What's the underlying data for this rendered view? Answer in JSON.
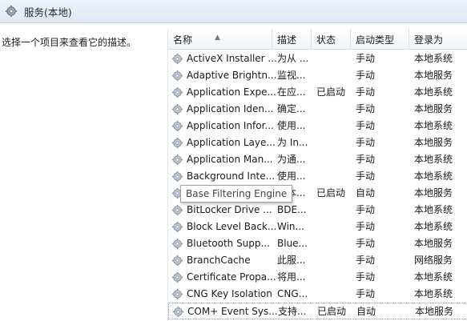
{
  "window": {
    "title": "服务(本地)",
    "icon": "services-gear-icon"
  },
  "description_pane": {
    "text": "选择一个项目来查看它的描述。"
  },
  "table": {
    "columns": [
      {
        "label": "名称",
        "sorted": "ascending"
      },
      {
        "label": "描述"
      },
      {
        "label": "状态"
      },
      {
        "label": "启动类型"
      },
      {
        "label": "登录为"
      }
    ],
    "rows": [
      {
        "name": "ActiveX Installer ...",
        "description": "为从 ...",
        "status": "",
        "startup": "手动",
        "logon": "本地系统"
      },
      {
        "name": "Adaptive Brightn...",
        "description": "监视...",
        "status": "",
        "startup": "手动",
        "logon": "本地服务"
      },
      {
        "name": "Application Expe...",
        "description": "在应...",
        "status": "已启动",
        "startup": "手动",
        "logon": "本地系统"
      },
      {
        "name": "Application Iden...",
        "description": "确定...",
        "status": "",
        "startup": "手动",
        "logon": "本地服务"
      },
      {
        "name": "Application Infor...",
        "description": "使用...",
        "status": "",
        "startup": "手动",
        "logon": "本地系统"
      },
      {
        "name": "Application Laye...",
        "description": "为 In...",
        "status": "",
        "startup": "手动",
        "logon": "本地服务"
      },
      {
        "name": "Application Man...",
        "description": "为通...",
        "status": "",
        "startup": "手动",
        "logon": "本地系统"
      },
      {
        "name": "Background Inte...",
        "description": "使用...",
        "status": "",
        "startup": "手动",
        "logon": "本地系统"
      },
      {
        "name": "Base Filtering En...",
        "description": "基本...",
        "status": "已启动",
        "startup": "自动",
        "logon": "本地服务"
      },
      {
        "name": "BitLocker Drive ...",
        "description": "BDE...",
        "status": "",
        "startup": "手动",
        "logon": "本地系统"
      },
      {
        "name": "Block Level Back...",
        "description": "Win...",
        "status": "",
        "startup": "手动",
        "logon": "本地系统"
      },
      {
        "name": "Bluetooth Supp...",
        "description": "Blue...",
        "status": "",
        "startup": "手动",
        "logon": "本地服务"
      },
      {
        "name": "BranchCache",
        "description": "此服...",
        "status": "",
        "startup": "手动",
        "logon": "网络服务"
      },
      {
        "name": "Certificate Propa...",
        "description": "将用...",
        "status": "",
        "startup": "手动",
        "logon": "本地系统"
      },
      {
        "name": "CNG Key Isolation",
        "description": "CNG...",
        "status": "",
        "startup": "手动",
        "logon": "本地系统"
      },
      {
        "name": "COM+ Event Sys...",
        "description": "支持...",
        "status": "已启动",
        "startup": "自动",
        "logon": "本地服务"
      }
    ]
  },
  "tooltip": {
    "text": "Base Filtering Engine"
  }
}
